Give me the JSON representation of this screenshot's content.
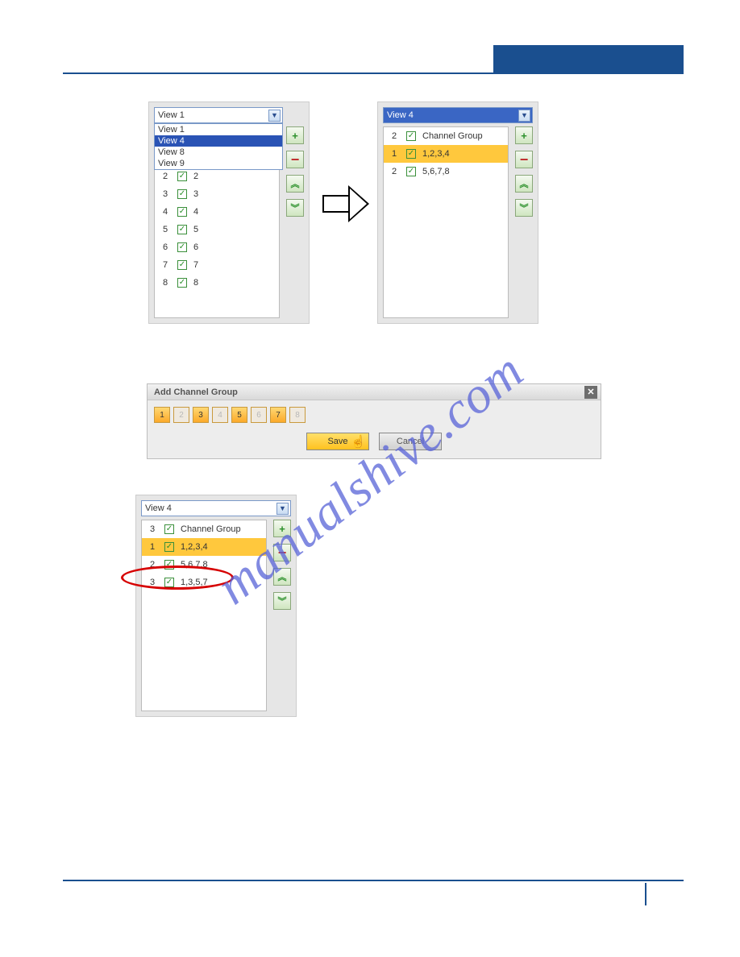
{
  "watermark": "manualshive.com",
  "panel_left": {
    "dropdown_value": "View 1",
    "options": [
      "View 1",
      "View 4",
      "View 8",
      "View 9"
    ],
    "selected_option": "View 4",
    "rows": [
      {
        "n": "2",
        "label": "2"
      },
      {
        "n": "3",
        "label": "3"
      },
      {
        "n": "4",
        "label": "4"
      },
      {
        "n": "5",
        "label": "5"
      },
      {
        "n": "6",
        "label": "6"
      },
      {
        "n": "7",
        "label": "7"
      },
      {
        "n": "8",
        "label": "8"
      }
    ]
  },
  "panel_right": {
    "dropdown_value": "View 4",
    "header": {
      "n": "2",
      "label": "Channel Group"
    },
    "rows": [
      {
        "n": "1",
        "label": "1,2,3,4",
        "sel": true
      },
      {
        "n": "2",
        "label": "5,6,7,8",
        "sel": false
      }
    ]
  },
  "dialog": {
    "title": "Add Channel Group",
    "channels": [
      {
        "n": "1",
        "on": true
      },
      {
        "n": "2",
        "on": false
      },
      {
        "n": "3",
        "on": true
      },
      {
        "n": "4",
        "on": false
      },
      {
        "n": "5",
        "on": true
      },
      {
        "n": "6",
        "on": false
      },
      {
        "n": "7",
        "on": true
      },
      {
        "n": "8",
        "on": false
      }
    ],
    "save_label": "Save",
    "cancel_label": "Cancel"
  },
  "panel_bottom": {
    "dropdown_value": "View 4",
    "header": {
      "n": "3",
      "label": "Channel Group"
    },
    "rows": [
      {
        "n": "1",
        "label": "1,2,3,4",
        "sel": true
      },
      {
        "n": "2",
        "label": "5,6,7,8",
        "sel": false
      },
      {
        "n": "3",
        "label": "1,3,5,7",
        "sel": false
      }
    ]
  },
  "btn_glyphs": {
    "plus": "+",
    "minus": "−",
    "up": "︽",
    "down": "︾",
    "caret": "▼",
    "check": "✓",
    "close": "✕",
    "hand": "✋",
    "arrow_cursor": "↖"
  }
}
